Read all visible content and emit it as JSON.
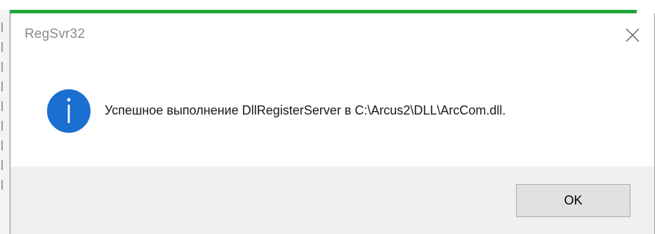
{
  "dialog": {
    "title": "RegSvr32",
    "message": "Успешное выполнение DllRegisterServer в C:\\Arcus2\\DLL\\ArcCom.dll.",
    "ok_label": "OK",
    "icon": "info-icon",
    "close_icon": "close-icon"
  },
  "colors": {
    "accent_green": "#1fa53a",
    "info_blue": "#1a6fd0",
    "footer_bg": "#f0f0f0",
    "button_bg": "#e1e1e1"
  }
}
